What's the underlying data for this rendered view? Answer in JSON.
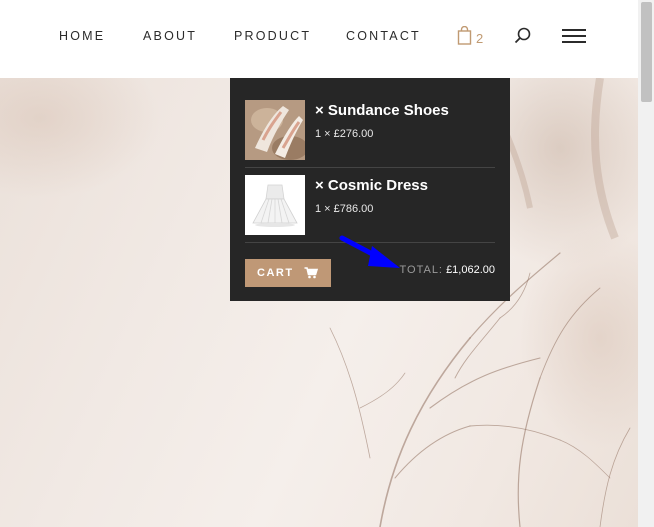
{
  "nav": {
    "items": [
      {
        "label": "HOME"
      },
      {
        "label": "ABOUT"
      },
      {
        "label": "PRODUCT"
      },
      {
        "label": "CONTACT"
      }
    ],
    "cart_count": "2"
  },
  "mini_cart": {
    "items": [
      {
        "name": "× Sundance Shoes",
        "qty_price": "1 × £276.00"
      },
      {
        "name": "× Cosmic Dress",
        "qty_price": "1 × £786.00"
      }
    ],
    "cart_button_label": "CART",
    "total_label": "TOTAL:",
    "total_value": "£1,062.00"
  },
  "colors": {
    "accent": "#bf9876",
    "dropdown_bg": "#262626",
    "annotation_arrow": "#0000ff"
  },
  "icons": [
    "shopping-bag-icon",
    "search-icon",
    "hamburger-menu-icon",
    "shopping-cart-icon"
  ]
}
